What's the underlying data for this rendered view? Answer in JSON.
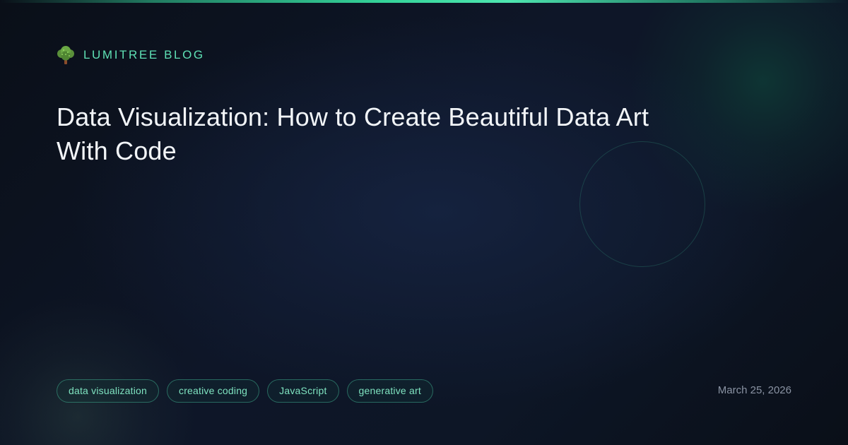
{
  "brand": {
    "icon": "tree-icon",
    "name": "LUMITREE BLOG"
  },
  "post": {
    "title": "Data Visualization: How to Create Beautiful Data Art With Code",
    "date": "March 25, 2026",
    "tags": [
      {
        "label": "data visualization"
      },
      {
        "label": "creative coding"
      },
      {
        "label": "JavaScript"
      },
      {
        "label": "generative art"
      }
    ]
  },
  "colors": {
    "accent": "#34d399",
    "brand_text": "#5ee0b4",
    "tag_text": "#7fe3c0",
    "title_text": "#f2f5f8",
    "date_text": "#8a93a3",
    "background": "#0c1220"
  }
}
